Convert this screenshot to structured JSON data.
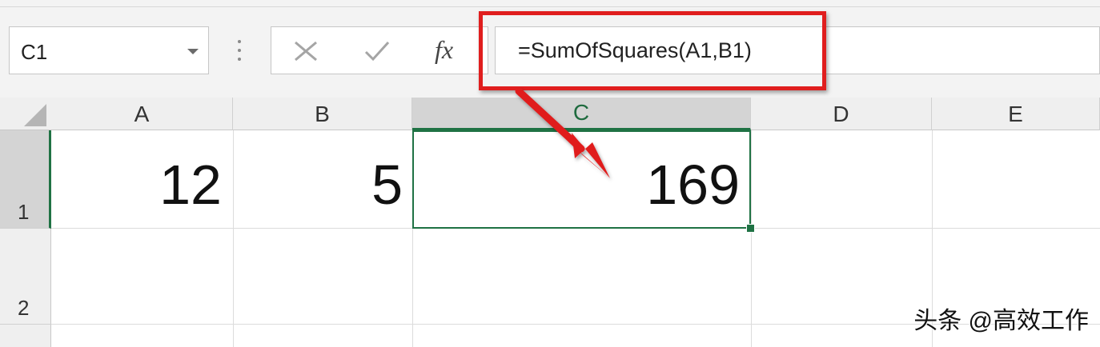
{
  "name_box": {
    "value": "C1"
  },
  "formula_bar": {
    "cancel_symbol": "✕",
    "enter_symbol": "✓",
    "fx_label": "fx",
    "formula": "=SumOfSquares(A1,B1)"
  },
  "grid": {
    "columns": [
      "A",
      "B",
      "C",
      "D",
      "E"
    ],
    "rows": [
      "1",
      "2"
    ],
    "cells": {
      "A1": "12",
      "B1": "5",
      "C1": "169"
    },
    "active_cell": "C1"
  },
  "annotation": {
    "color": "#e01e1e"
  },
  "colors": {
    "selection": "#1f7244",
    "annotation_red": "#e01e1e"
  },
  "watermark": "头条 @高效工作"
}
